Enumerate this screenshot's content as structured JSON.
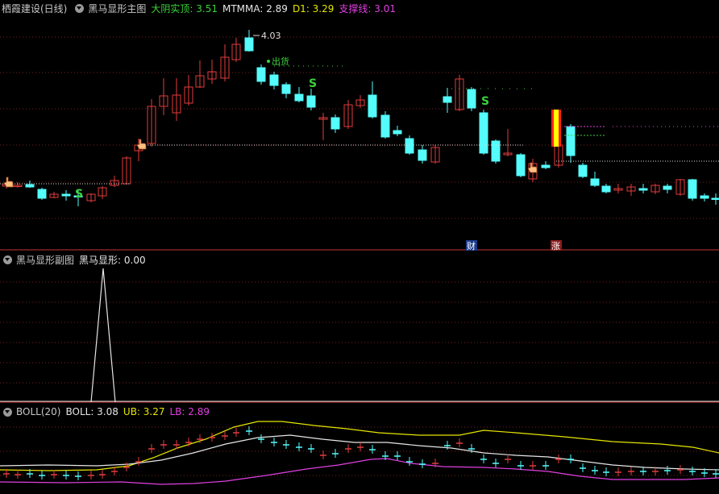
{
  "main_panel": {
    "stock": "栖霞建设(日线)",
    "indicator": "黑马显形主图",
    "items": [
      {
        "label": "大阴实顶:",
        "value": "3.51",
        "color": "#3cd23c"
      },
      {
        "label": "MTMMA:",
        "value": "2.89",
        "color": "#e6e6e6"
      },
      {
        "label": "D1:",
        "value": "3.29",
        "color": "#e6e600"
      },
      {
        "label": "支撑线:",
        "value": "3.01",
        "color": "#e040e0"
      }
    ],
    "peak_label": "4.03",
    "ship_label": "出货",
    "signal_s": "S",
    "badge_cai": "财",
    "badge_zhang": "涨"
  },
  "sub_panel": {
    "indicator": "黑马显形副图",
    "items": [
      {
        "label": "黑马显形:",
        "value": "0.00",
        "color": "#e6e6e6"
      }
    ]
  },
  "boll_panel": {
    "indicator": "BOLL(20)",
    "items": [
      {
        "label": "BOLL:",
        "value": "3.08",
        "color": "#e6e6e6"
      },
      {
        "label": "UB:",
        "value": "3.27",
        "color": "#e6e600"
      },
      {
        "label": "LB:",
        "value": "2.89",
        "color": "#e040e0"
      }
    ]
  },
  "colors": {
    "up": "#e23c3c",
    "down": "#54fcfc",
    "grid": "#7a2020",
    "signal": "#3cd23c",
    "boll_mid": "#e6e6e6",
    "boll_ub": "#e6e600",
    "boll_lb": "#e040e0"
  },
  "icons": [
    "collapse-arrow-icon",
    "hand-pointer-icon"
  ]
}
